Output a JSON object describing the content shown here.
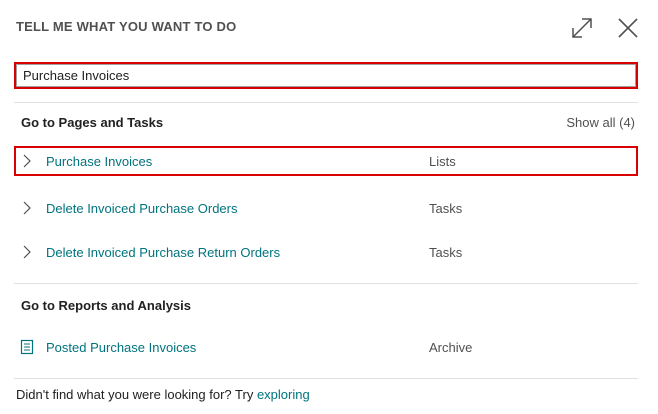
{
  "dialog": {
    "title": "TELL ME WHAT YOU WANT TO DO",
    "icons": {
      "expand": "expand-icon",
      "close": "close-icon"
    }
  },
  "search": {
    "value": "Purchase Invoices"
  },
  "pages_section": {
    "title": "Go to Pages and Tasks",
    "show_all": "Show all (4)",
    "items": [
      {
        "label": "Purchase Invoices",
        "kind": "Lists"
      },
      {
        "label": "Delete Invoiced Purchase Orders",
        "kind": "Tasks"
      },
      {
        "label": "Delete Invoiced Purchase Return Orders",
        "kind": "Tasks"
      }
    ]
  },
  "reports_section": {
    "title": "Go to Reports and Analysis",
    "items": [
      {
        "label": "Posted Purchase Invoices",
        "kind": "Archive"
      }
    ]
  },
  "footer": {
    "text": "Didn't find what you were looking for? Try ",
    "link": "exploring"
  },
  "colors": {
    "accent": "#00737e",
    "highlight": "#d90000"
  }
}
